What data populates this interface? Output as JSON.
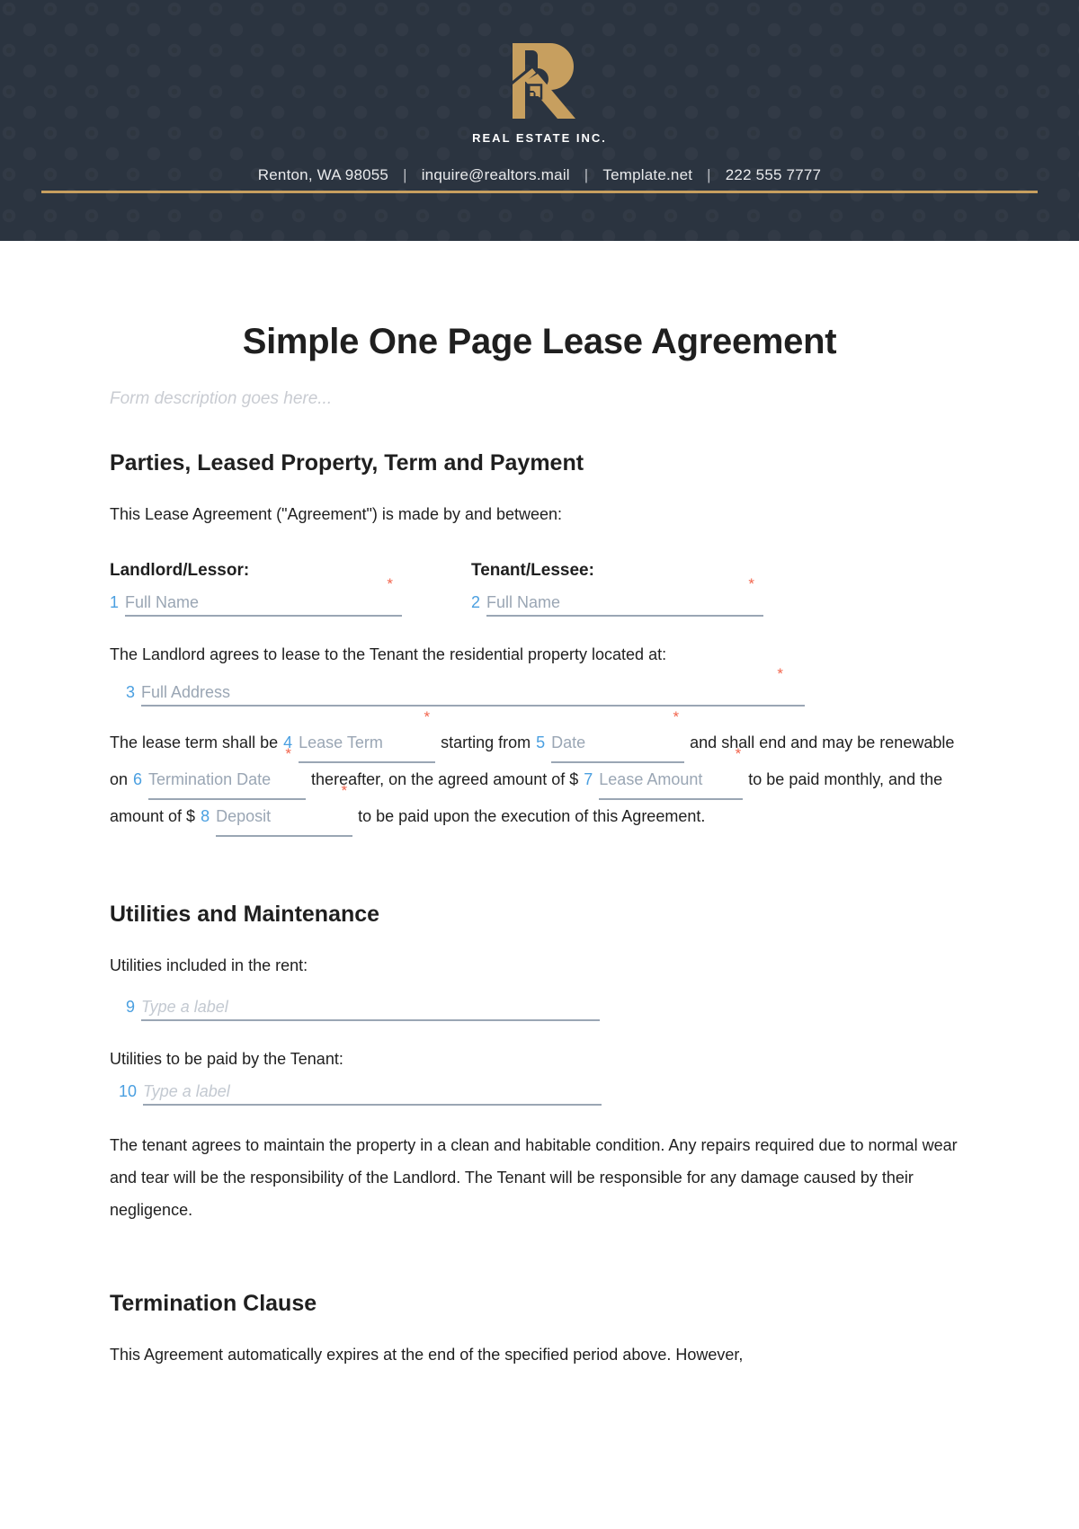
{
  "header": {
    "brand_name": "REAL ESTATE INC.",
    "logo_icon": "real-estate-r-house-logo",
    "contacts": [
      "Renton, WA 98055",
      "inquire@realtors.mail",
      "Template.net",
      "222 555 7777"
    ],
    "separator": "|",
    "background_color": "#2b3440",
    "accent_color": "#c79f5f"
  },
  "document": {
    "title": "Simple One Page Lease Agreement",
    "description": "Form description goes here...",
    "required_marker": "*"
  },
  "sections": {
    "parties": {
      "heading": "Parties, Leased Property, Term and Payment",
      "intro": "This Lease Agreement (\"Agreement\") is made by and between:",
      "landlord_label": "Landlord/Lessor:",
      "tenant_label": "Tenant/Lessee:",
      "property_intro": "The Landlord agrees to lease to the Tenant the residential property located at:",
      "term_text": {
        "t1": "The lease term shall be",
        "t2": "starting from",
        "t3": "and shall end and may be renewable on",
        "t4": "thereafter, on the agreed amount of $",
        "t5": "to be paid monthly, and the amount of $",
        "t6": "to be paid upon the execution of this Agreement."
      }
    },
    "utilities": {
      "heading": "Utilities and Maintenance",
      "included_label": "Utilities included in the rent:",
      "tenant_paid_label": "Utilities to be paid by the Tenant:",
      "maintenance_text": "The tenant agrees to maintain the property in a clean and habitable condition. Any repairs required due to normal wear and tear will be the responsibility of the Landlord. The Tenant will be responsible for any damage caused by their negligence."
    },
    "termination": {
      "heading": "Termination Clause",
      "body": "This Agreement automatically expires at the end of the specified period above. However,"
    }
  },
  "fields": [
    {
      "num": "1",
      "placeholder": "Full Name",
      "required": true,
      "style": "normal"
    },
    {
      "num": "2",
      "placeholder": "Full Name",
      "required": true,
      "style": "normal"
    },
    {
      "num": "3",
      "placeholder": "Full Address",
      "required": true,
      "style": "normal"
    },
    {
      "num": "4",
      "placeholder": "Lease Term",
      "required": true,
      "style": "normal"
    },
    {
      "num": "5",
      "placeholder": "Date",
      "required": true,
      "style": "normal"
    },
    {
      "num": "6",
      "placeholder": "Termination Date",
      "required": true,
      "style": "normal"
    },
    {
      "num": "7",
      "placeholder": "Lease Amount",
      "required": true,
      "style": "normal"
    },
    {
      "num": "8",
      "placeholder": "Deposit",
      "required": true,
      "style": "normal"
    },
    {
      "num": "9",
      "placeholder": "Type a label",
      "required": false,
      "style": "italic"
    },
    {
      "num": "10",
      "placeholder": "Type a label",
      "required": false,
      "style": "italic"
    }
  ],
  "colors": {
    "field_number": "#4a9fe0",
    "placeholder": "#9aa6b4",
    "required_star": "#f2654d",
    "text": "#1f1f1f"
  }
}
